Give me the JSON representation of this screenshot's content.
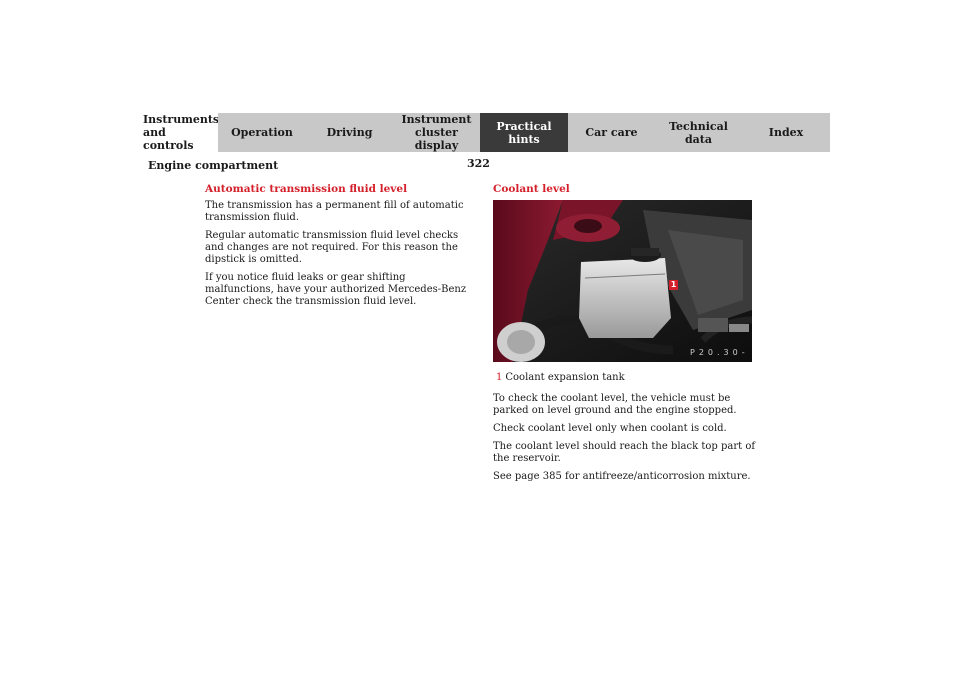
{
  "tabs": [
    {
      "label": "Instruments\nand controls",
      "active": false
    },
    {
      "label": "Operation",
      "active": false
    },
    {
      "label": "Driving",
      "active": false
    },
    {
      "label": "Instrument\ncluster display",
      "active": false
    },
    {
      "label": "Practical hints",
      "active": true
    },
    {
      "label": "Car care",
      "active": false
    },
    {
      "label": "Technical\ndata",
      "active": false
    },
    {
      "label": "Index",
      "active": false
    }
  ],
  "page": {
    "number": "322",
    "section_title": "Engine compartment"
  },
  "left": {
    "heading": "Automatic transmission fluid level",
    "paragraphs": [
      "The transmission has a permanent fill of automatic transmission fluid.",
      "Regular automatic transmission fluid level checks and changes are not required. For this reason the dipstick is omitted.",
      "If you notice fluid leaks or gear shifting malfunctions, have your authorized Mercedes-Benz Center check the transmission fluid level."
    ]
  },
  "right": {
    "heading": "Coolant level",
    "figure": {
      "callout": "1",
      "code": "P20.30-"
    },
    "caption": {
      "number": "1",
      "text": "Coolant expansion tank"
    },
    "paragraphs": [
      "To check the coolant level, the vehicle must be parked on level ground and the engine stopped.",
      "Check coolant level only when coolant is cold.",
      "The coolant level should reach the black top part of the reservoir.",
      "See page 385 for antifreeze/anticorrosion mixture."
    ]
  },
  "colors": {
    "accent": "#d4202a",
    "tab_active": "#3a3a3a",
    "tab_inactive": "#c8c8c8"
  }
}
